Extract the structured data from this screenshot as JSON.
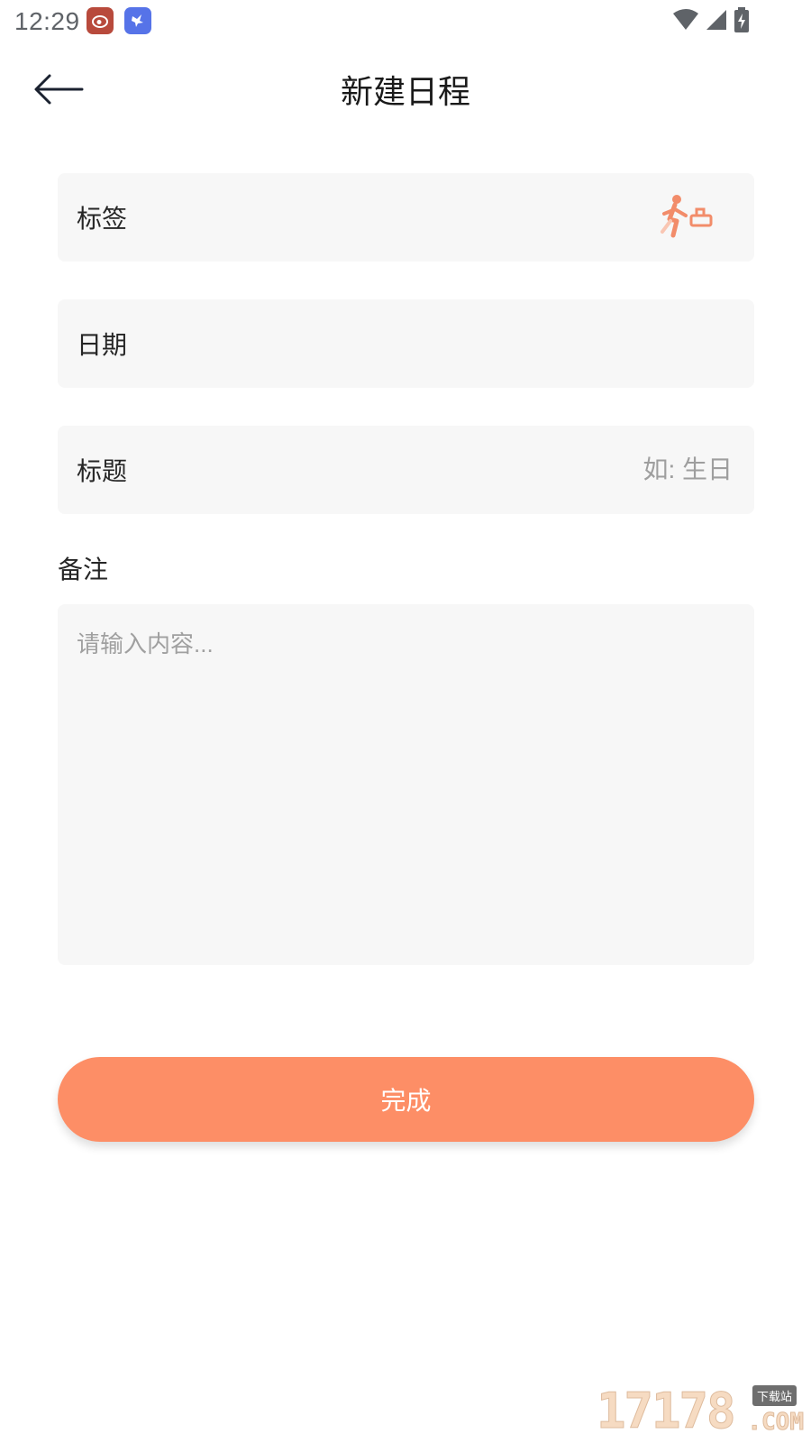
{
  "status_bar": {
    "time": "12:29",
    "notifications": [
      "weibo-icon",
      "bird-app-icon"
    ],
    "indicators": [
      "wifi-icon",
      "cell-signal-icon",
      "battery-charging-icon"
    ]
  },
  "header": {
    "title": "新建日程",
    "back_icon": "arrow-left-icon"
  },
  "form": {
    "tag": {
      "label": "标签",
      "selected_icon": "running-figure-icon"
    },
    "date": {
      "label": "日期",
      "value": ""
    },
    "title": {
      "label": "标题",
      "value": "",
      "placeholder": "如: 生日"
    },
    "note": {
      "label": "备注",
      "value": "",
      "placeholder": "请输入内容..."
    }
  },
  "actions": {
    "done_label": "完成"
  },
  "watermark": {
    "digits": "17178",
    "badge": "下载站",
    "suffix": ".COM"
  },
  "colors": {
    "accent": "#fd8e66",
    "field_background": "#f7f7f7",
    "placeholder": "#9e9e9e",
    "text": "#262626"
  }
}
